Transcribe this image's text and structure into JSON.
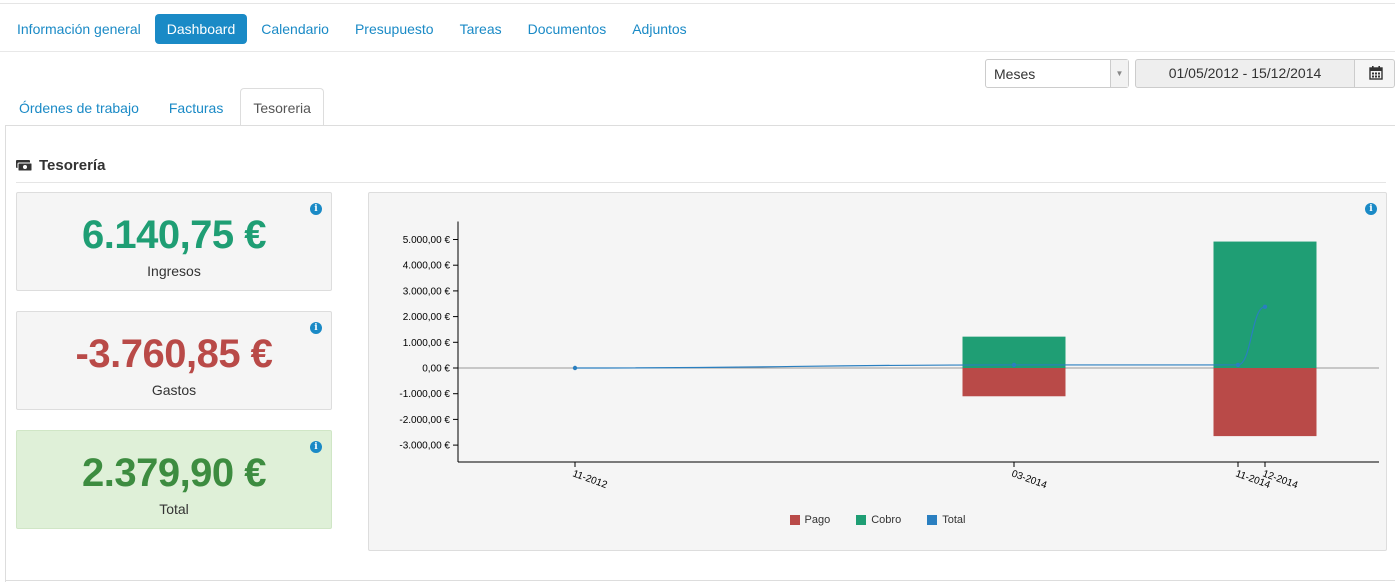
{
  "nav": {
    "pills": [
      {
        "label": "Información general",
        "active": false
      },
      {
        "label": "Dashboard",
        "active": true
      },
      {
        "label": "Calendario",
        "active": false
      },
      {
        "label": "Presupuesto",
        "active": false
      },
      {
        "label": "Tareas",
        "active": false
      },
      {
        "label": "Documentos",
        "active": false
      },
      {
        "label": "Adjuntos",
        "active": false
      }
    ]
  },
  "filters": {
    "period_selected": "Meses",
    "date_range": "01/05/2012 - 15/12/2014",
    "calendar_icon": "calendar-icon"
  },
  "tabs": [
    {
      "label": "Órdenes de trabajo",
      "active": false
    },
    {
      "label": "Facturas",
      "active": false
    },
    {
      "label": "Tesoreria",
      "active": true
    }
  ],
  "section": {
    "title": "Tesorería",
    "icon": "money-icon"
  },
  "stats": {
    "ingresos": {
      "amount": "6.140,75 €",
      "label": "Ingresos",
      "color": "#1f9e74"
    },
    "gastos": {
      "amount": "-3.760,85 €",
      "label": "Gastos",
      "color": "#b94a48"
    },
    "total": {
      "amount": "2.379,90 €",
      "label": "Total",
      "color": "#3d8c40"
    }
  },
  "colors": {
    "accent": "#1a8ac6",
    "pago": "#b94a48",
    "cobro": "#1f9e74",
    "total": "#2a7fc0"
  },
  "chart_data": {
    "type": "bar",
    "x": [
      "11-2012",
      "03-2014",
      "11-2014",
      "12-2014"
    ],
    "series": [
      {
        "name": "Pago",
        "values": [
          0,
          -1100,
          -2650,
          null
        ]
      },
      {
        "name": "Cobro",
        "values": [
          0,
          1220,
          4920,
          null
        ]
      },
      {
        "name": "Total",
        "type": "line",
        "values": [
          0,
          120,
          120,
          2380
        ]
      }
    ],
    "yticks": [
      "5.000,00 €",
      "4.000,00 €",
      "3.000,00 €",
      "2.000,00 €",
      "1.000,00 €",
      "0,00 €",
      "-1.000,00 €",
      "-2.000,00 €",
      "-3.000,00 €"
    ],
    "ylim": [
      -3500,
      5700
    ],
    "legend": [
      "Pago",
      "Cobro",
      "Total"
    ],
    "legend_position": "bottom"
  }
}
